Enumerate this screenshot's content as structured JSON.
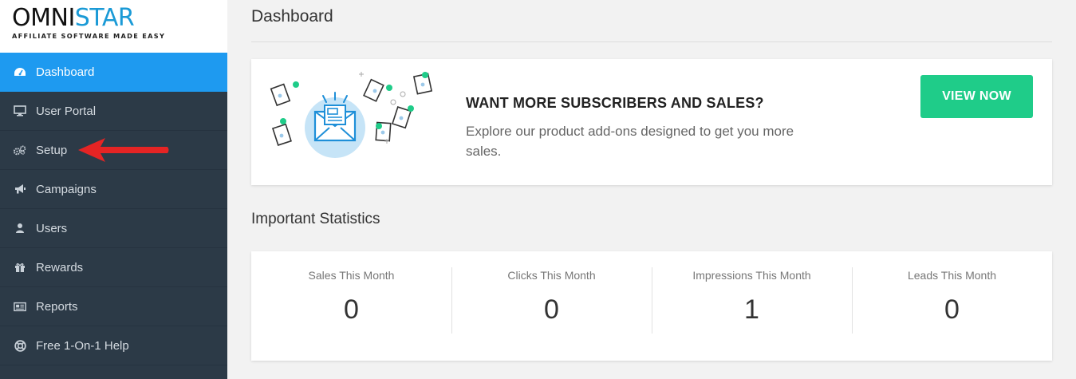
{
  "logo": {
    "name_part1": "OMNI",
    "name_part2": "ST",
    "name_part3": "AR",
    "tagline": "AFFILIATE SOFTWARE MADE EASY"
  },
  "sidebar": {
    "items": [
      {
        "label": "Dashboard",
        "icon": "dashboard-icon",
        "active": true
      },
      {
        "label": "User Portal",
        "icon": "monitor-icon"
      },
      {
        "label": "Setup",
        "icon": "cogs-icon"
      },
      {
        "label": "Campaigns",
        "icon": "megaphone-icon"
      },
      {
        "label": "Users",
        "icon": "user-icon"
      },
      {
        "label": "Rewards",
        "icon": "gift-icon"
      },
      {
        "label": "Reports",
        "icon": "newspaper-icon"
      },
      {
        "label": "Free 1-On-1 Help",
        "icon": "lifebuoy-icon"
      }
    ]
  },
  "page": {
    "title": "Dashboard"
  },
  "promo": {
    "heading": "WANT MORE SUBSCRIBERS AND SALES?",
    "body": "Explore our product add-ons designed to get you more sales.",
    "button_label": "VIEW NOW"
  },
  "stats": {
    "title": "Important Statistics",
    "items": [
      {
        "label": "Sales This Month",
        "value": "0"
      },
      {
        "label": "Clicks This Month",
        "value": "0"
      },
      {
        "label": "Impressions This Month",
        "value": "1"
      },
      {
        "label": "Leads This Month",
        "value": "0"
      }
    ]
  },
  "colors": {
    "sidebar_bg": "#2c3a47",
    "active_item": "#1e9af0",
    "button_green": "#1fcc89",
    "annotation_arrow": "#e52424"
  }
}
